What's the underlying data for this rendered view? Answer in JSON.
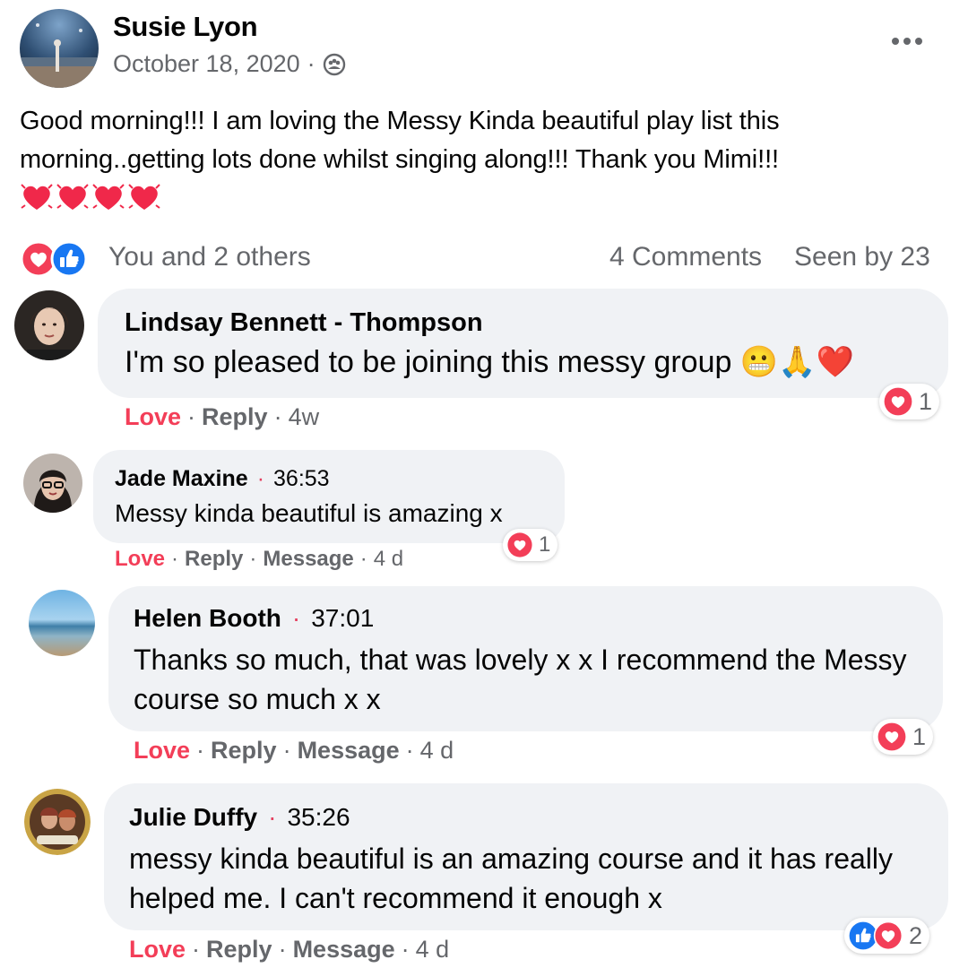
{
  "post": {
    "author": "Susie Lyon",
    "date": "October 18, 2020",
    "separator": "·",
    "audience_icon": "group-icon",
    "text": "Good morning!!! I am loving the Messy Kinda beautiful play list this morning..getting lots done whilst singing along!!! Thank you Mimi!!!",
    "emoji_hearts": [
      "💓",
      "💓",
      "💓",
      "💓"
    ]
  },
  "reactions": {
    "summary": "You and 2 others",
    "comments": "4 Comments",
    "seen_by": "Seen by 23",
    "icons": [
      "love-icon",
      "like-icon"
    ]
  },
  "comments": [
    {
      "name": "Lindsay Bennett - Thompson",
      "time": "",
      "text": "I'm so pleased to be joining this messy group 😬🙏❤️",
      "love": "Love",
      "reply": "Reply",
      "message": "",
      "age": "4w",
      "reaction_count": "1"
    },
    {
      "name": "Jade Maxine",
      "dot": "·",
      "time": "36:53",
      "text": "Messy kinda beautiful is amazing x",
      "love": "Love",
      "reply": "Reply",
      "message": "Message",
      "age": "4 d",
      "reaction_count": "1"
    },
    {
      "name": "Helen Booth",
      "dot": "·",
      "time": "37:01",
      "text": "Thanks so much, that was lovely x x I recommend the Messy course so much x x",
      "love": "Love",
      "reply": "Reply",
      "message": "Message",
      "age": "4 d",
      "reaction_count": "1"
    },
    {
      "name": "Julie Duffy",
      "dot": "·",
      "time": "35:26",
      "text": "messy kinda beautiful is an amazing course and it has really helped me. I can't recommend it enough x",
      "love": "Love",
      "reply": "Reply",
      "message": "Message",
      "age": "4 d",
      "reaction_count": "2"
    }
  ],
  "sep": "·",
  "colors": {
    "love": "#f33e58",
    "like": "#1877f2",
    "muted": "#65676b",
    "bubble": "#f0f2f5",
    "dot": "#e4405f"
  }
}
